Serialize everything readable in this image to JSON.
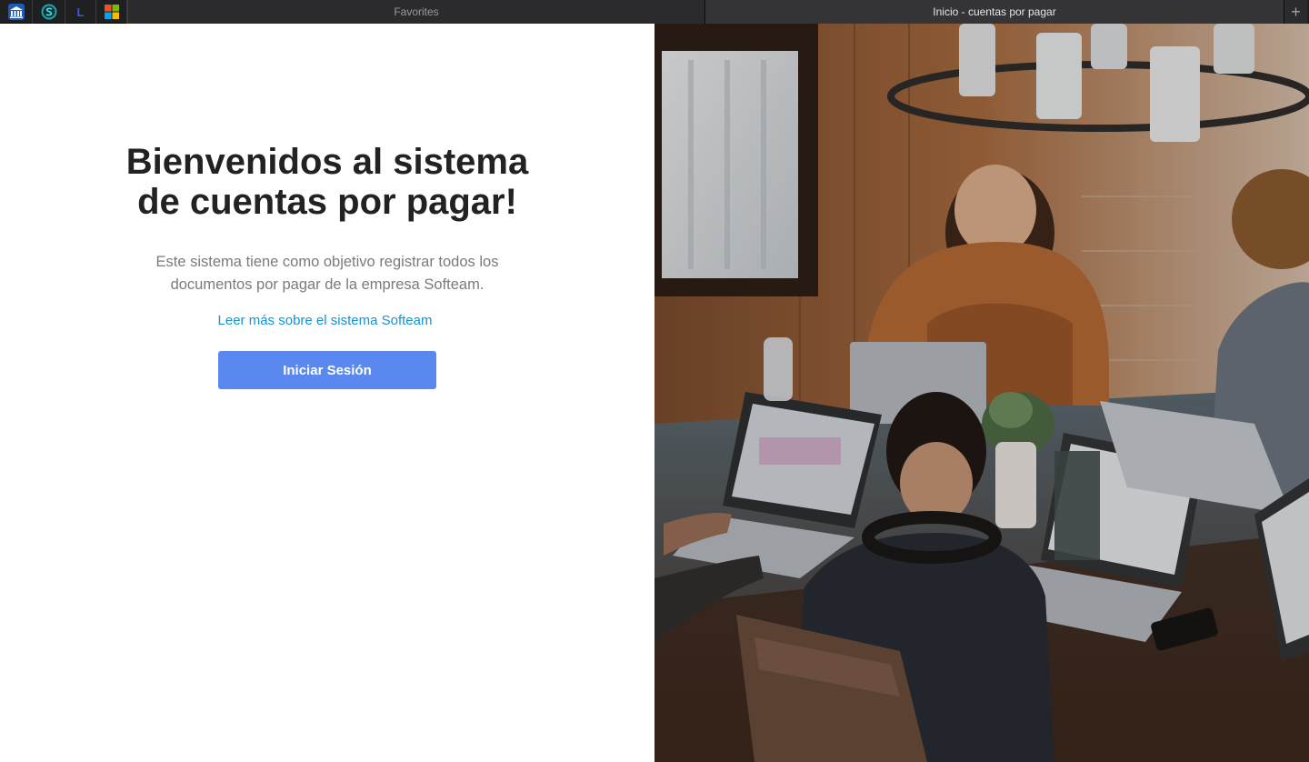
{
  "browser": {
    "favorites_tab_label": "Favorites",
    "active_tab_title": "Inicio - cuentas por pagar",
    "new_tab_symbol": "+",
    "favicons": [
      {
        "icon": "bank-icon"
      },
      {
        "icon": "s-circle-icon"
      },
      {
        "icon": "letter-l-icon",
        "text": "L"
      },
      {
        "icon": "microsoft-icon"
      }
    ]
  },
  "page": {
    "title_line1": "Bienvenidos al sistema",
    "title_line2": "de cuentas por pagar!",
    "description": "Este sistema tiene como objetivo registrar todos los documentos por pagar de la empresa Softeam.",
    "read_more_link": "Leer más sobre el sistema Softeam",
    "login_button": "Iniciar Sesión"
  },
  "colors": {
    "accent_button": "#5b88ee",
    "link": "#0f96d6",
    "title_text": "#222222",
    "body_text": "#7b7b7b"
  },
  "hero_image": {
    "icon": "photo-icon",
    "subject": "people working on laptops around a wooden table"
  }
}
